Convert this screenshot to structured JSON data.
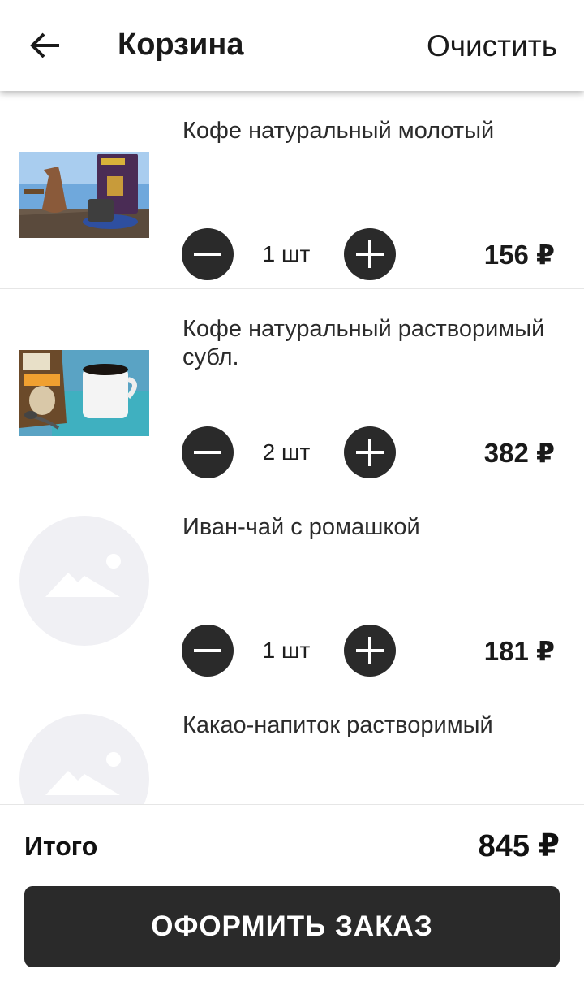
{
  "header": {
    "title": "Корзина",
    "clear_label": "Очистить",
    "back_icon": "arrow-left-icon"
  },
  "items": [
    {
      "name": "Кофе натуральный молотый",
      "quantity": "1 шт",
      "price": "156 ₽",
      "image": "photo-coffee-cezve"
    },
    {
      "name": "Кофе натуральный растворимый субл.",
      "quantity": "2 шт",
      "price": "382 ₽",
      "image": "photo-coffee-cup"
    },
    {
      "name": "Иван-чай с ромашкой",
      "quantity": "1 шт",
      "price": "181 ₽",
      "image": "image-placeholder-icon"
    },
    {
      "name": "Какао-напиток растворимый",
      "quantity": "",
      "price": "",
      "image": "image-placeholder-icon"
    }
  ],
  "footer": {
    "total_label": "Итого",
    "total_value": "845 ₽",
    "checkout_label": "ОФОРМИТЬ ЗАКАЗ"
  },
  "colors": {
    "button_dark": "#2a2a2a",
    "placeholder_bg": "#f0f0f4",
    "placeholder_fg": "#ffffff"
  }
}
